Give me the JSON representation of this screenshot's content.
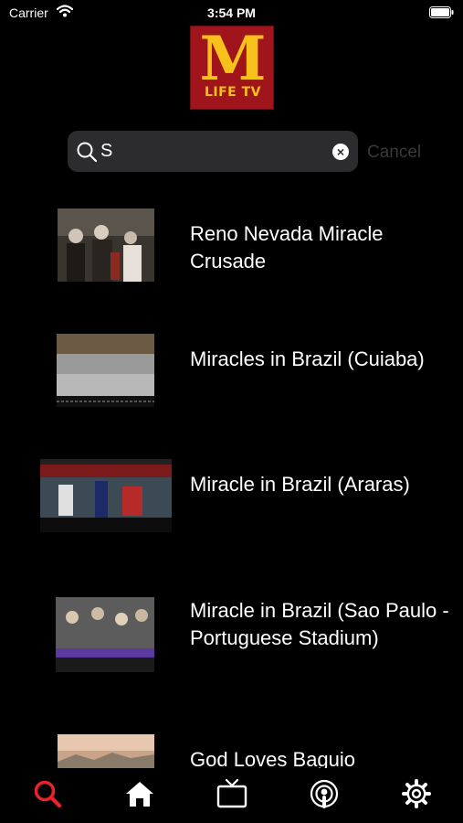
{
  "status_bar": {
    "carrier": "Carrier",
    "time": "3:54 PM"
  },
  "logo": {
    "letter": "M",
    "subtitle": "LIFE TV"
  },
  "search": {
    "value": "S",
    "cancel_label": "Cancel"
  },
  "results": [
    {
      "title": "Reno Nevada Miracle Crusade"
    },
    {
      "title": "Miracles in Brazil (Cuiaba)"
    },
    {
      "title": "Miracle in Brazil (Araras)"
    },
    {
      "title": "Miracle in Brazil (Sao Paulo - Portuguese Stadium)"
    },
    {
      "title": "God Loves Baguio"
    }
  ],
  "tabs": [
    {
      "icon": "search-icon",
      "active": true
    },
    {
      "icon": "home-icon",
      "active": false
    },
    {
      "icon": "tv-icon",
      "active": false
    },
    {
      "icon": "podcast-icon",
      "active": false
    },
    {
      "icon": "gear-icon",
      "active": false
    }
  ],
  "colors": {
    "accent": "#e8232a",
    "logo_bg": "#a0141b",
    "logo_text": "#f7c11b",
    "search_bg": "#2c2c2e"
  }
}
